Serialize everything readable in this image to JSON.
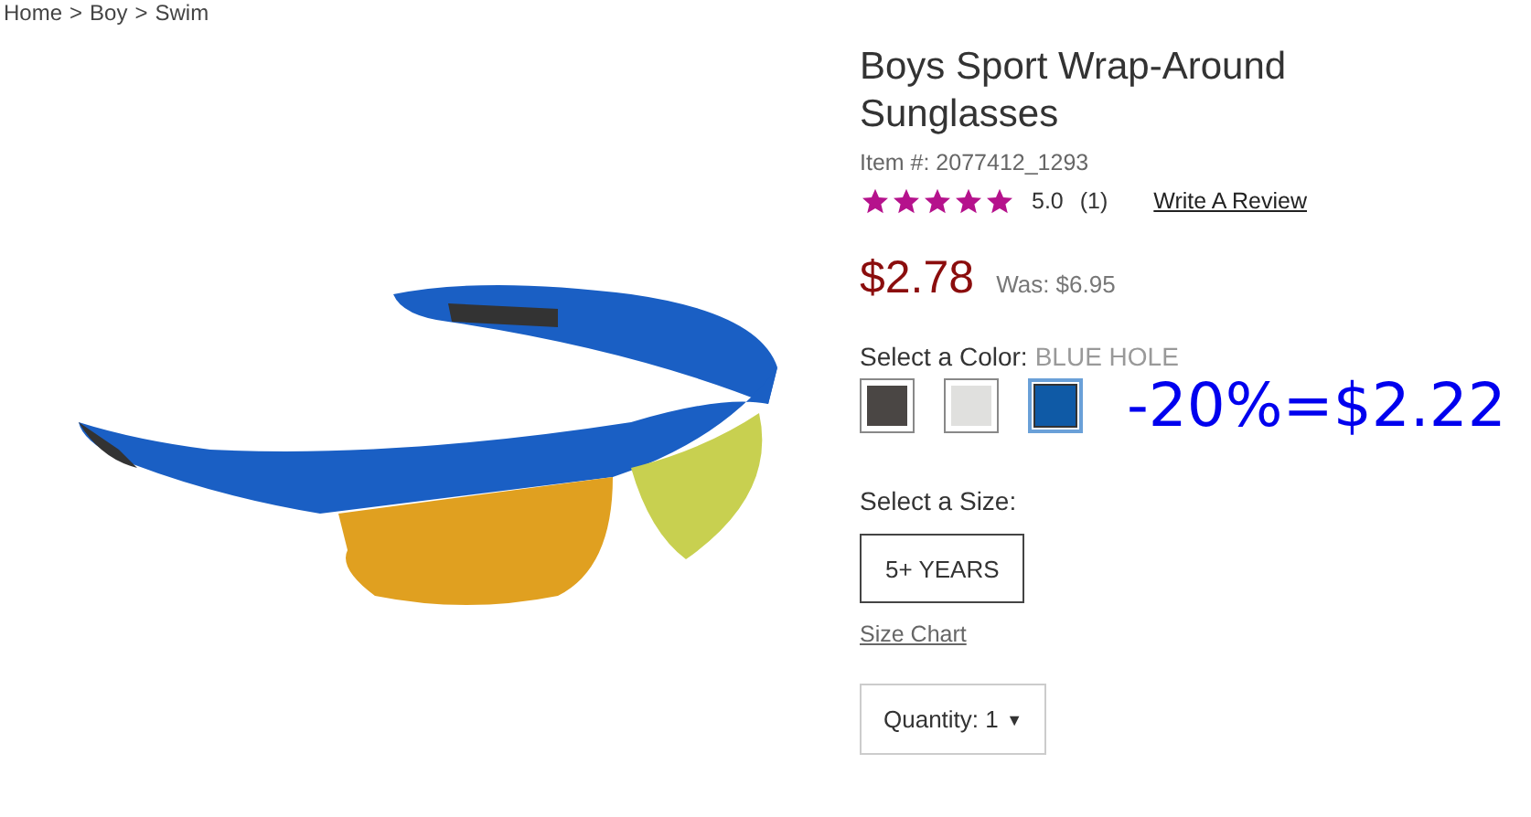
{
  "breadcrumb": [
    "Home",
    "Boy",
    "Swim"
  ],
  "breadcrumb_separator": ">",
  "product": {
    "title": "Boys Sport Wrap-Around Sunglasses",
    "item_number": "Item #: 2077412_1293",
    "stars": 5,
    "rating": "5.0",
    "review_count": "(1)",
    "write_review": "Write A Review",
    "price": "$2.78",
    "was_price": "Was: $6.95"
  },
  "color": {
    "label": "Select a Color:",
    "value": "BLUE HOLE",
    "swatches": [
      {
        "color": "#4a4644",
        "selected": false
      },
      {
        "color": "#e0e0de",
        "selected": false
      },
      {
        "color": "#0f5aa6",
        "selected": true
      }
    ]
  },
  "size": {
    "label": "Select a Size:",
    "options": [
      {
        "label": "5+ YEARS",
        "selected": true
      }
    ],
    "size_chart": "Size Chart"
  },
  "quantity": {
    "label": "Quantity:",
    "value": "1",
    "arrow": "▼"
  },
  "overlay_note": "-20%=$2.22"
}
